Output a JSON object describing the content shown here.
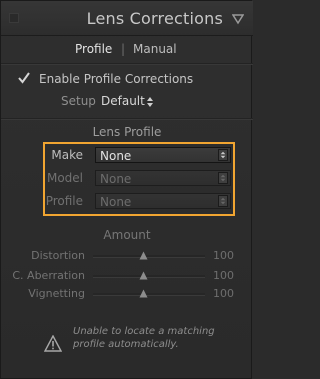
{
  "panel": {
    "title": "Lens Corrections"
  },
  "tabs": [
    {
      "label": "Profile",
      "active": true
    },
    {
      "label": "Manual",
      "active": false
    }
  ],
  "tab_separator": "|",
  "enable_profile": {
    "label": "Enable Profile Corrections",
    "checked": true
  },
  "setup": {
    "label": "Setup",
    "value": "Default"
  },
  "lens_profile": {
    "title": "Lens Profile",
    "fields": [
      {
        "label": "Make",
        "value": "None",
        "enabled": true
      },
      {
        "label": "Model",
        "value": "None",
        "enabled": false
      },
      {
        "label": "Profile",
        "value": "None",
        "enabled": false
      }
    ]
  },
  "amount": {
    "title": "Amount",
    "sliders": [
      {
        "label": "Distortion",
        "value": "100",
        "fraction": 0.45
      },
      {
        "label": "C. Aberration",
        "value": "100",
        "fraction": 0.45
      },
      {
        "label": "Vignetting",
        "value": "100",
        "fraction": 0.45
      }
    ]
  },
  "warning": {
    "line1": "Unable to locate a matching",
    "line2": "profile automatically."
  },
  "colors": {
    "highlight": "#f1a531",
    "panel_bg": "#2b2b2b"
  },
  "icons": {
    "collapse": "triangle-down-icon",
    "checkmark": "checkmark-icon",
    "warning": "warning-triangle-icon",
    "stepper": "up-down-arrows-icon"
  }
}
